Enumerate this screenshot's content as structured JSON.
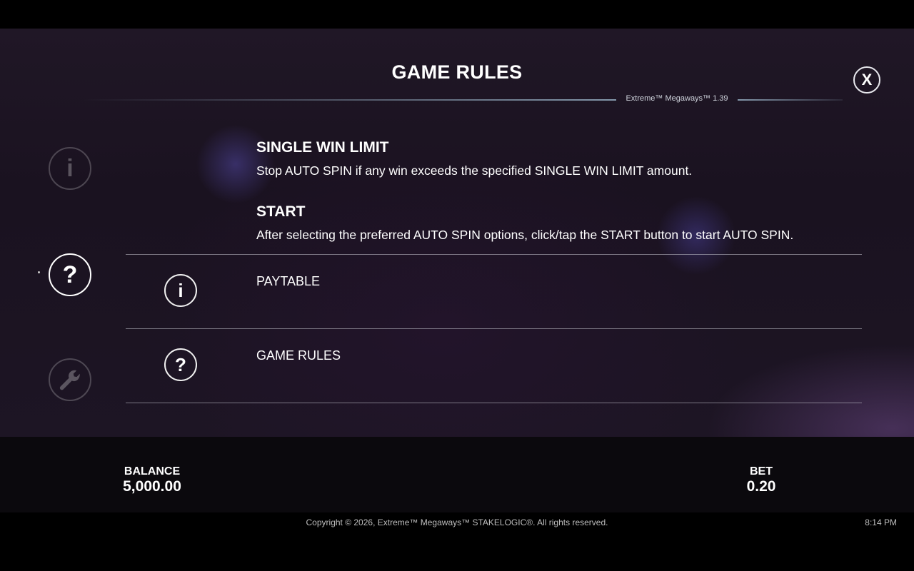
{
  "panel": {
    "title": "GAME RULES",
    "version": "Extreme™ Megaways™ 1.39",
    "close_label": "X"
  },
  "side_nav": {
    "items": [
      {
        "name": "paytable",
        "icon": "info-icon",
        "glyph": "i",
        "active": false
      },
      {
        "name": "game-rules",
        "icon": "question-icon",
        "glyph": "?",
        "active": true
      },
      {
        "name": "settings",
        "icon": "wrench-icon",
        "active": false
      }
    ]
  },
  "rules": [
    {
      "heading": "SINGLE WIN LIMIT",
      "text": "Stop AUTO SPIN if any win exceeds the specified SINGLE WIN LIMIT amount."
    },
    {
      "heading": "START",
      "text": "After selecting the preferred AUTO SPIN options, click/tap the START button to start AUTO SPIN."
    }
  ],
  "menu": {
    "items": [
      {
        "label": "PAYTABLE",
        "icon": "info-icon",
        "glyph": "i"
      },
      {
        "label": "GAME RULES",
        "icon": "question-icon",
        "glyph": "?"
      }
    ]
  },
  "footer": {
    "balance_label": "BALANCE",
    "balance_value": "5,000.00",
    "bet_label": "BET",
    "bet_value": "0.20",
    "copyright": "Copyright © 2026, Extreme™ Megaways™ STAKELOGIC®. All rights reserved.",
    "time": "8:14 PM"
  }
}
